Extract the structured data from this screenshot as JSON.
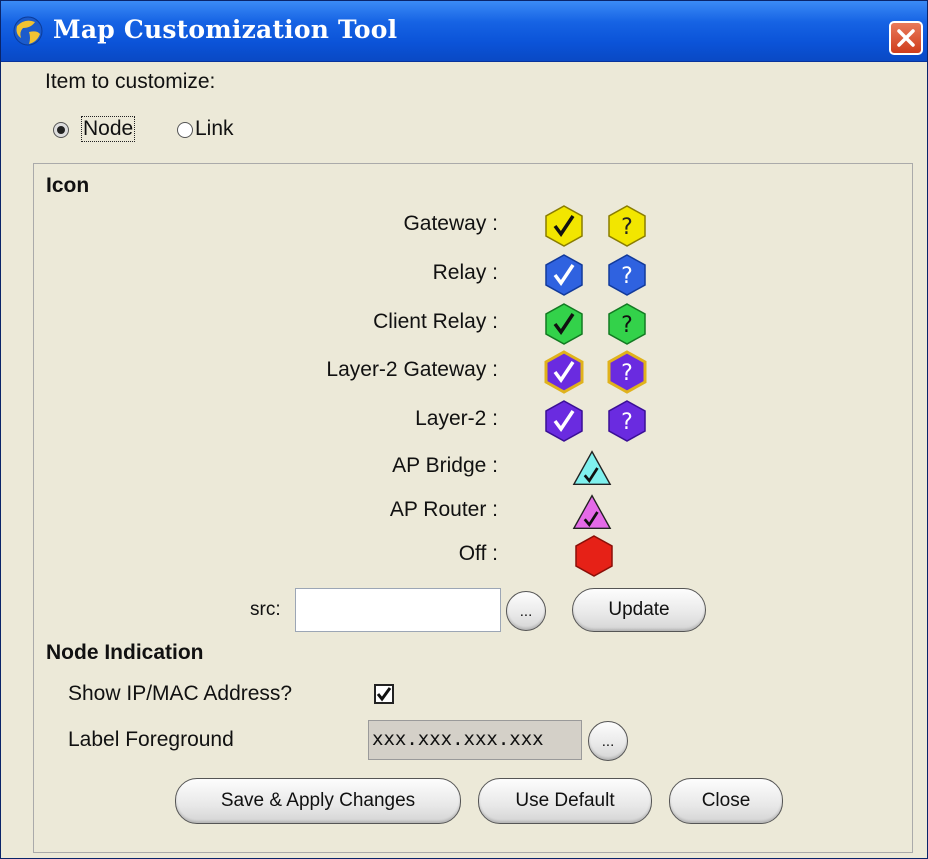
{
  "window": {
    "title": "Map Customization Tool",
    "app_icon": "globe-icon",
    "close_icon": "close-icon"
  },
  "item_to_customize": {
    "label": "Item to customize:",
    "options": [
      {
        "label": "Node",
        "selected": true
      },
      {
        "label": "Link",
        "selected": false
      }
    ]
  },
  "icon_section": {
    "title": "Icon",
    "rows": [
      {
        "label": "Gateway :",
        "icons": [
          "check",
          "question"
        ],
        "color": "#f2e600",
        "variant": "hexagon"
      },
      {
        "label": "Relay :",
        "icons": [
          "check",
          "question"
        ],
        "color": "#2f62e0",
        "variant": "hexagon"
      },
      {
        "label": "Client Relay :",
        "icons": [
          "check",
          "question"
        ],
        "color": "#33d24a",
        "variant": "hexagon"
      },
      {
        "label": "Layer-2 Gateway :",
        "icons": [
          "check",
          "question"
        ],
        "color": "#6a2be0",
        "variant": "hexagon-gold"
      },
      {
        "label": "Layer-2 :",
        "icons": [
          "check",
          "question"
        ],
        "color": "#6a2be0",
        "variant": "hexagon"
      },
      {
        "label": "AP Bridge :",
        "icons": [
          "check"
        ],
        "color": "#7ff1ee",
        "variant": "triangle"
      },
      {
        "label": "AP Router :",
        "icons": [
          "check"
        ],
        "color": "#e46ae8",
        "variant": "triangle"
      },
      {
        "label": "Off :",
        "icons": [
          "none"
        ],
        "color": "#e62117",
        "variant": "hexagon"
      }
    ],
    "src_label": "src:",
    "src_value": "",
    "browse_label": "...",
    "update_label": "Update"
  },
  "node_indication": {
    "title": "Node Indication",
    "show_ip_label": "Show IP/MAC Address?",
    "show_ip_checked": true,
    "label_foreground_label": "Label Foreground",
    "label_foreground_value": "xxx.xxx.xxx.xxx",
    "browse_label": "..."
  },
  "buttons": {
    "save": "Save & Apply Changes",
    "use_default": "Use Default",
    "close": "Close"
  }
}
